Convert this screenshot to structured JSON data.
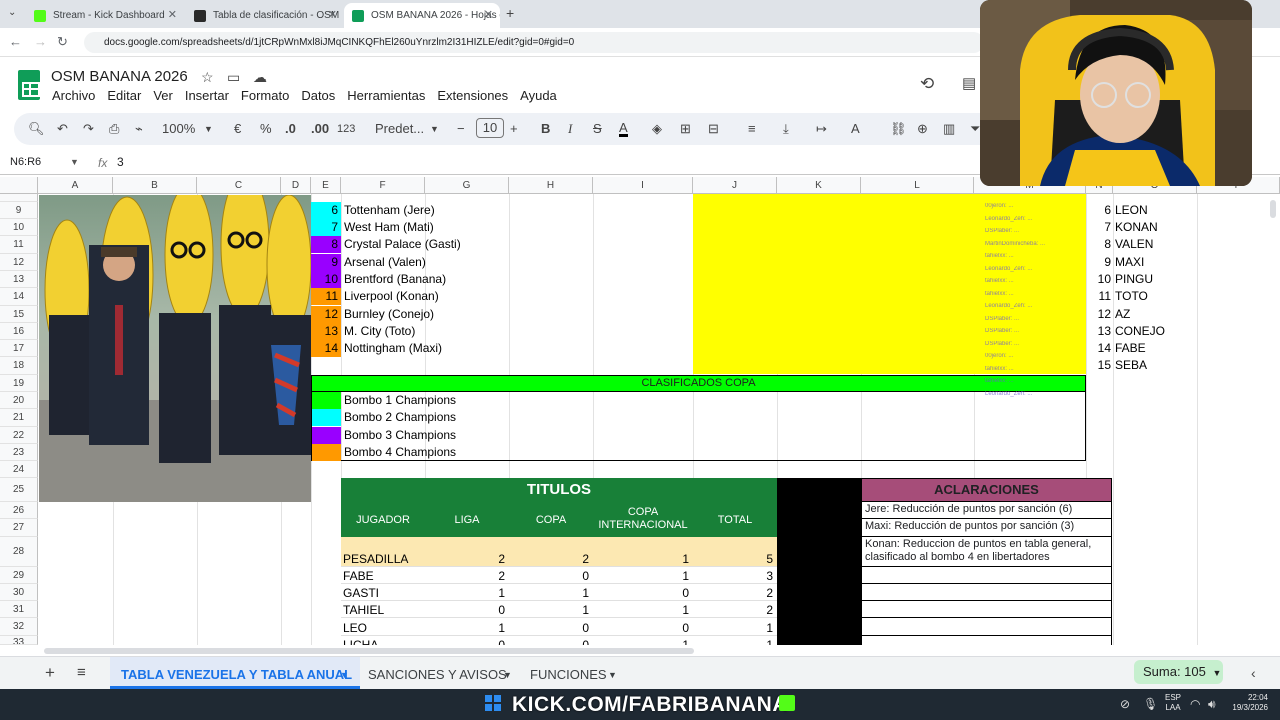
{
  "browser": {
    "tabs": [
      {
        "title": "Stream - Kick Dashboard",
        "favicon_color": "#53fc18"
      },
      {
        "title": "Tabla de clasificación - OSM",
        "favicon_color": "#2a2a2a"
      },
      {
        "title": "OSM BANANA 2026 - Hojas de cá",
        "favicon_color": "#0f9d58"
      }
    ],
    "url": "docs.google.com/spreadsheets/d/1jtCRpWnMxl8iJMqCINKQFhEl260uYnrzlm2I31HIZLE/edit?gid=0#gid=0"
  },
  "sheets": {
    "title": "OSM BANANA 2026",
    "menu": [
      "Archivo",
      "Editar",
      "Ver",
      "Insertar",
      "Formato",
      "Datos",
      "Herramientas",
      "Extensiones",
      "Ayuda"
    ],
    "toolbar": {
      "zoom": "100%",
      "currency": "€",
      "percent": "%",
      "dec_less": ".0",
      "dec_more": ".00",
      "format": "123",
      "font": "Predet...",
      "font_size": "10"
    },
    "name_box": "N6:R6",
    "fx": "fx",
    "formula": "3",
    "columns": [
      "A",
      "B",
      "C",
      "D",
      "E",
      "F",
      "G",
      "H",
      "I",
      "J",
      "K",
      "L",
      "M",
      "N",
      "O",
      "P"
    ],
    "rows": [
      "9",
      "10",
      "11",
      "12",
      "13",
      "14",
      "15",
      "16",
      "17",
      "18",
      "19",
      "20",
      "21",
      "22",
      "23",
      "24",
      "25",
      "26",
      "27",
      "28",
      "29",
      "30",
      "31",
      "32",
      "33"
    ],
    "teams": [
      {
        "num": "6",
        "name": "Tottenham (Jere)",
        "color": "#00ffff"
      },
      {
        "num": "7",
        "name": "West Ham (Mati)",
        "color": "#00ffff"
      },
      {
        "num": "8",
        "name": "Crystal Palace (Gasti)",
        "color": "#9900ff"
      },
      {
        "num": "9",
        "name": "Arsenal (Valen)",
        "color": "#9900ff"
      },
      {
        "num": "10",
        "name": "Brentford (Banana)",
        "color": "#9900ff"
      },
      {
        "num": "11",
        "name": "Liverpool (Konan)",
        "color": "#ff9900"
      },
      {
        "num": "12",
        "name": "Burnley (Conejo)",
        "color": "#ff9900"
      },
      {
        "num": "13",
        "name": "M. City (Toto)",
        "color": "#ff9900"
      },
      {
        "num": "14",
        "name": "Nottingham (Maxi)",
        "color": "#ff9900"
      }
    ],
    "ranking": [
      {
        "num": "6",
        "name": "LEON"
      },
      {
        "num": "7",
        "name": "KONAN"
      },
      {
        "num": "8",
        "name": "VALEN"
      },
      {
        "num": "9",
        "name": "MAXI"
      },
      {
        "num": "10",
        "name": "PINGU"
      },
      {
        "num": "11",
        "name": "TOTO"
      },
      {
        "num": "12",
        "name": "AZ"
      },
      {
        "num": "13",
        "name": "CONEJO"
      },
      {
        "num": "14",
        "name": "FABE"
      },
      {
        "num": "15",
        "name": "SEBA"
      }
    ],
    "copa_header": "CLASIFICADOS COPA",
    "bombos": [
      {
        "label": "Bombo 1 Champions",
        "color": "#00ff00"
      },
      {
        "label": "Bombo 2 Champions",
        "color": "#00ffff"
      },
      {
        "label": "Bombo 3 Champions",
        "color": "#9900ff"
      },
      {
        "label": "Bombo 4 Champions",
        "color": "#ff9900"
      }
    ],
    "titulos": {
      "title": "TITULOS",
      "headers": [
        "JUGADOR",
        "LIGA",
        "COPA",
        "COPA INTERNACIONAL",
        "TOTAL"
      ],
      "rows": [
        [
          "PESADILLA",
          "2",
          "2",
          "1",
          "5"
        ],
        [
          "FABE",
          "2",
          "0",
          "1",
          "3"
        ],
        [
          "GASTI",
          "1",
          "1",
          "0",
          "2"
        ],
        [
          "TAHIEL",
          "0",
          "1",
          "1",
          "2"
        ],
        [
          "LEO",
          "1",
          "0",
          "0",
          "1"
        ],
        [
          "LICHA",
          "0",
          "0",
          "1",
          "1"
        ]
      ]
    },
    "aclaraciones": {
      "title": "ACLARACIONES",
      "rows": [
        "Jere: Reducción de puntos por sanción (6)",
        "Maxi: Reducción de puntos por sanción (3)",
        "Konan: Reduccion de puntos en tabla general, clasificado al bombo 4 en libertadores"
      ]
    },
    "chat": [
      "00jeron: ...",
      "Leonardo_Zeh: ...",
      "DSPlaber: ...",
      "MartinDominicheba: ...",
      "tahielxx: ...",
      "Leonardo_Zeh: ...",
      "tahielxx: ...",
      "tahielxx: ...",
      "Leonardo_Zeh: ...",
      "DSPlaber: ...",
      "DSPlaber: ...",
      "DSPlaber: ...",
      "00jeron: ...",
      "tahielxx: ...",
      "tahielxx: ...",
      "Leonardo_Zeh: ..."
    ],
    "sheet_tabs": [
      "TABLA VENEZUELA Y TABLA ANUAL",
      "SANCIONES Y AVISOS",
      "FUNCIONES"
    ],
    "sum": "Suma: 105"
  },
  "taskbar": {
    "overlay": "KICK.COM/FABRIBANANA",
    "lang": "ESP",
    "lang2": "LAA",
    "time": "22:04",
    "date": "19/3/2026"
  }
}
